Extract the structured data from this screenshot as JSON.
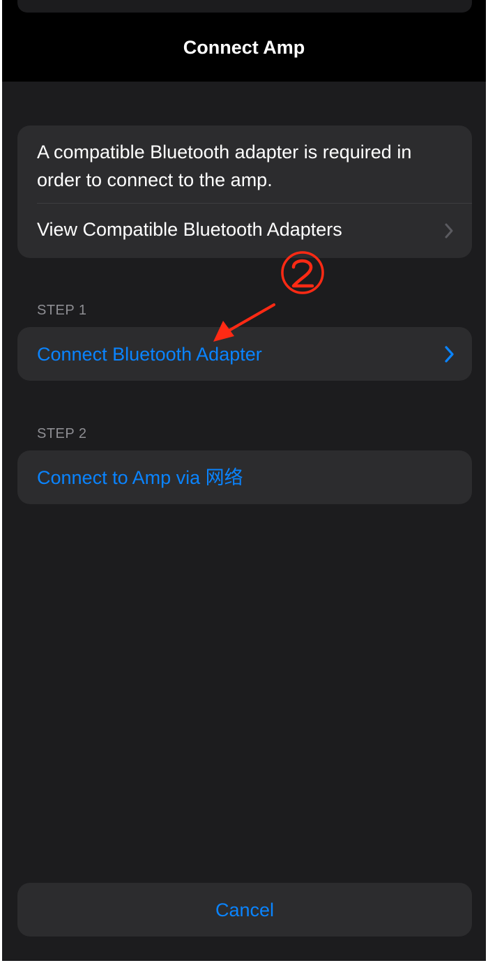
{
  "header": {
    "title": "Connect Amp"
  },
  "info_card": {
    "description": "A compatible Bluetooth adapter is required in order to connect to the amp.",
    "view_adapters_label": "View Compatible Bluetooth Adapters",
    "chevron_icon": "chevron-right-icon"
  },
  "step1": {
    "header": "STEP 1",
    "label": "Connect Bluetooth Adapter",
    "chevron_icon": "chevron-right-icon"
  },
  "step2": {
    "header": "STEP 2",
    "label": "Connect to Amp via 网络"
  },
  "footer": {
    "cancel_label": "Cancel"
  },
  "annotation": {
    "number": "②",
    "arrow_icon": "red-arrow-icon",
    "color": "#ff2a14"
  },
  "colors": {
    "background": "#1c1c1e",
    "header_background": "#000000",
    "card_background": "#2c2c2e",
    "accent": "#0a84ff",
    "secondary_text": "#8e8e93",
    "chevron_gray": "#5b5b60"
  }
}
